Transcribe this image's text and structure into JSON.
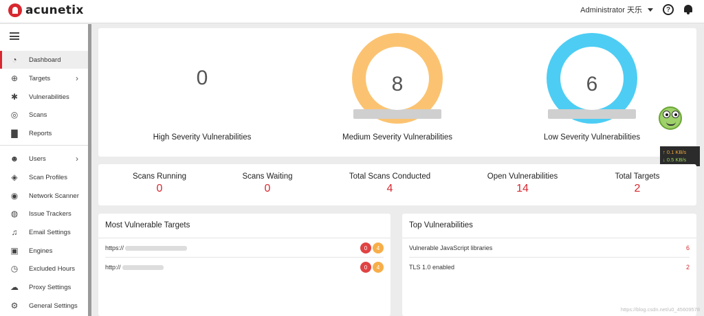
{
  "app": {
    "brand": "acunetix"
  },
  "topbar": {
    "user": "Administrator 天乐",
    "help_glyph": "?"
  },
  "sidebar": {
    "items": [
      {
        "label": "Dashboard",
        "icon": "gauge-icon",
        "active": true
      },
      {
        "label": "Targets",
        "icon": "crosshair-icon",
        "has_submenu": true
      },
      {
        "label": "Vulnerabilities",
        "icon": "bug-icon"
      },
      {
        "label": "Scans",
        "icon": "radar-icon"
      },
      {
        "label": "Reports",
        "icon": "document-icon"
      },
      {
        "label": "Users",
        "icon": "users-icon",
        "has_submenu": true
      },
      {
        "label": "Scan Profiles",
        "icon": "shield-icon"
      },
      {
        "label": "Network Scanner",
        "icon": "network-icon"
      },
      {
        "label": "Issue Trackers",
        "icon": "tracker-icon"
      },
      {
        "label": "Email Settings",
        "icon": "bell-icon"
      },
      {
        "label": "Engines",
        "icon": "chip-icon"
      },
      {
        "label": "Excluded Hours",
        "icon": "clock-icon"
      },
      {
        "label": "Proxy Settings",
        "icon": "cloud-icon"
      },
      {
        "label": "General Settings",
        "icon": "gear-icon"
      }
    ]
  },
  "severity": {
    "high": {
      "value": "0",
      "label": "High Severity Vulnerabilities"
    },
    "medium": {
      "value": "8",
      "label": "Medium Severity Vulnerabilities",
      "color": "#fbc371"
    },
    "low": {
      "value": "6",
      "label": "Low Severity Vulnerabilities",
      "color": "#4dcdf4"
    }
  },
  "netspeed": {
    "up": "↑ 0.1 KB/s",
    "down": "↓ 0.5 KB/s"
  },
  "stats": [
    {
      "label": "Scans Running",
      "value": "0"
    },
    {
      "label": "Scans Waiting",
      "value": "0"
    },
    {
      "label": "Total Scans Conducted",
      "value": "4"
    },
    {
      "label": "Open Vulnerabilities",
      "value": "14"
    },
    {
      "label": "Total Targets",
      "value": "2"
    }
  ],
  "most_vulnerable": {
    "title": "Most Vulnerable Targets",
    "rows": [
      {
        "url": "https://",
        "high": "0",
        "medium": "4"
      },
      {
        "url": "http://",
        "high": "0",
        "medium": "4"
      }
    ]
  },
  "top_vulnerabilities": {
    "title": "Top Vulnerabilities",
    "rows": [
      {
        "name": "Vulnerable JavaScript libraries",
        "count": "6"
      },
      {
        "name": "TLS 1.0 enabled",
        "count": "2"
      }
    ]
  },
  "watermark": "https://blog.csdn.net/u0_45609578"
}
